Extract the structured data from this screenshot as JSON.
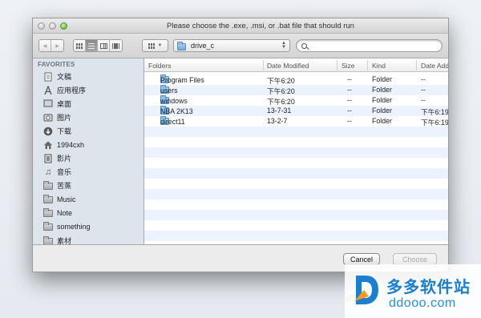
{
  "window": {
    "title": "Please choose the .exe, .msi, or .bat file that should run"
  },
  "toolbar": {
    "back_label": "◀",
    "forward_label": "▶",
    "path": "drive_c",
    "search_placeholder": ""
  },
  "sidebar": {
    "header": "FAVORITES",
    "items": [
      {
        "label": "文稿",
        "icon": "document-icon"
      },
      {
        "label": "应用程序",
        "icon": "applications-icon"
      },
      {
        "label": "桌面",
        "icon": "desktop-icon"
      },
      {
        "label": "图片",
        "icon": "pictures-icon"
      },
      {
        "label": "下载",
        "icon": "downloads-icon"
      },
      {
        "label": "1994cxh",
        "icon": "home-icon"
      },
      {
        "label": "影片",
        "icon": "movies-icon"
      },
      {
        "label": "音乐",
        "icon": "music-icon"
      },
      {
        "label": "苦蒸",
        "icon": "folder-icon"
      },
      {
        "label": "Music",
        "icon": "folder-icon"
      },
      {
        "label": "Note",
        "icon": "folder-icon"
      },
      {
        "label": "something",
        "icon": "folder-icon"
      },
      {
        "label": "素材",
        "icon": "folder-icon"
      }
    ]
  },
  "file_list": {
    "columns": [
      "Folders",
      "Date Modified",
      "Size",
      "Kind",
      "Date Add"
    ],
    "rows": [
      {
        "name": "Program Files",
        "modified": "下午6:20",
        "size": "--",
        "kind": "Folder",
        "added": "--"
      },
      {
        "name": "users",
        "modified": "下午6:20",
        "size": "--",
        "kind": "Folder",
        "added": "--"
      },
      {
        "name": "windows",
        "modified": "下午6:20",
        "size": "--",
        "kind": "Folder",
        "added": "--"
      },
      {
        "name": "NBA 2K13",
        "modified": "13-7-31",
        "size": "--",
        "kind": "Folder",
        "added": "下午6:19"
      },
      {
        "name": "direct11",
        "modified": "13-2-7",
        "size": "--",
        "kind": "Folder",
        "added": "下午6:19"
      }
    ]
  },
  "buttons": {
    "cancel": "Cancel",
    "choose": "Choose"
  },
  "watermark": {
    "cn": "多多软件站",
    "en": "ddooo.com"
  }
}
